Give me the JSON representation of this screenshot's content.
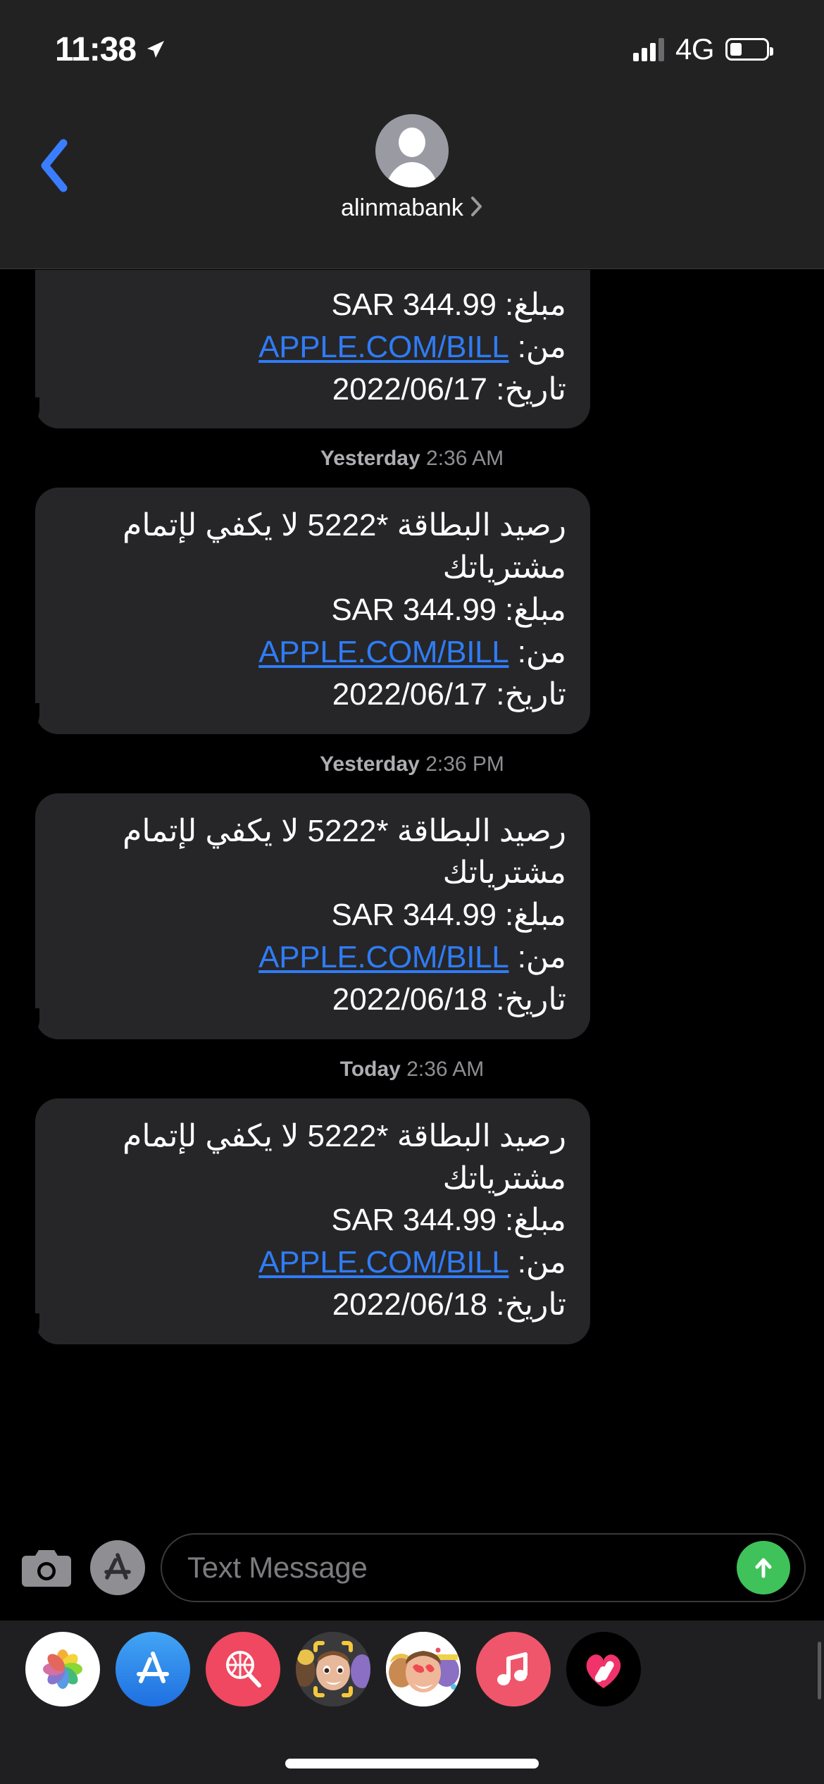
{
  "status_bar": {
    "time": "11:38",
    "location_icon": "location-arrow-icon",
    "signal_icon": "cellular-signal-icon",
    "network": "4G",
    "battery_icon": "battery-icon"
  },
  "nav_bar": {
    "back_icon": "chevron-left-icon",
    "avatar_icon": "default-contact-avatar",
    "contact_name": "alinmabank",
    "disclosure_icon": "chevron-right-icon"
  },
  "conversation": {
    "messages": [
      {
        "id": "msg-1",
        "timestamp": null,
        "clipped": true,
        "lines": [
          {
            "type": "text",
            "label": "مبلغ:",
            "value": "SAR 344.99",
            "full": "مبلغ: SAR 344.99"
          },
          {
            "type": "link",
            "label": "من:",
            "value": "APPLE.COM/BILL"
          },
          {
            "type": "text",
            "label": "تاريخ:",
            "value": "2022/06/17",
            "full": "تاريخ: 2022/06/17"
          }
        ]
      },
      {
        "id": "msg-2",
        "timestamp": {
          "day": "Yesterday",
          "time": "2:36 AM"
        },
        "clipped": false,
        "body": "رصيد البطاقة *5222 لا يكفي لإتمام مشترياتك",
        "lines": [
          {
            "type": "text",
            "label": "مبلغ:",
            "value": "SAR 344.99",
            "full": "مبلغ: SAR 344.99"
          },
          {
            "type": "link",
            "label": "من:",
            "value": "APPLE.COM/BILL"
          },
          {
            "type": "text",
            "label": "تاريخ:",
            "value": "2022/06/17",
            "full": "تاريخ: 2022/06/17"
          }
        ]
      },
      {
        "id": "msg-3",
        "timestamp": {
          "day": "Yesterday",
          "time": "2:36 PM"
        },
        "clipped": false,
        "body": "رصيد البطاقة *5222 لا يكفي لإتمام مشترياتك",
        "lines": [
          {
            "type": "text",
            "label": "مبلغ:",
            "value": "SAR 344.99",
            "full": "مبلغ: SAR 344.99"
          },
          {
            "type": "link",
            "label": "من:",
            "value": "APPLE.COM/BILL"
          },
          {
            "type": "text",
            "label": "تاريخ:",
            "value": "2022/06/18",
            "full": "تاريخ: 2022/06/18"
          }
        ]
      },
      {
        "id": "msg-4",
        "timestamp": {
          "day": "Today",
          "time": "2:36 AM"
        },
        "clipped": false,
        "body": "رصيد البطاقة *5222 لا يكفي لإتمام مشترياتك",
        "lines": [
          {
            "type": "text",
            "label": "مبلغ:",
            "value": "SAR 344.99",
            "full": "مبلغ: SAR 344.99"
          },
          {
            "type": "link",
            "label": "من:",
            "value": "APPLE.COM/BILL"
          },
          {
            "type": "text",
            "label": "تاريخ:",
            "value": "2022/06/18",
            "full": "تاريخ: 2022/06/18"
          }
        ]
      }
    ]
  },
  "input_bar": {
    "camera_icon": "camera-icon",
    "appstore_icon": "app-store-icon",
    "placeholder": "Text Message",
    "value": "",
    "send_icon": "send-arrow-up-icon",
    "send_color": "#3fc25a"
  },
  "app_drawer": {
    "apps": [
      {
        "name": "photos-app-icon",
        "label": "Photos"
      },
      {
        "name": "app-store-app-icon",
        "label": "App Store"
      },
      {
        "name": "images-search-app-icon",
        "label": "#images"
      },
      {
        "name": "memoji-app-icon",
        "label": "Memoji"
      },
      {
        "name": "memoji-stickers-app-icon",
        "label": "Memoji Stickers"
      },
      {
        "name": "apple-music-app-icon",
        "label": "Music"
      },
      {
        "name": "fitness-app-icon",
        "label": "Fitness"
      }
    ]
  },
  "colors": {
    "background": "#000000",
    "bar": "#222223",
    "bubble": "#262628",
    "link": "#2f7cf6",
    "accent_blue": "#3b7dff",
    "send_green": "#3fc25a",
    "timestamp_text": "#8e8e93"
  }
}
